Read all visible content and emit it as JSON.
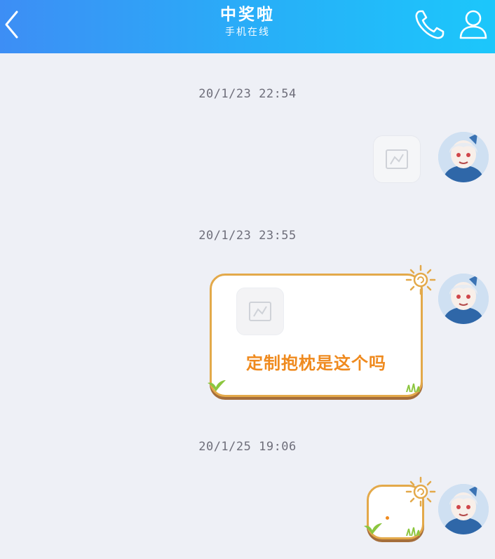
{
  "header": {
    "title": "中奖啦",
    "subtitle": "手机在线",
    "back_icon": "chevron-left-icon",
    "call_icon": "phone-icon",
    "profile_icon": "person-icon"
  },
  "messages": [
    {
      "timestamp": "20/1/23 22:54",
      "type": "image",
      "sender": "self"
    },
    {
      "timestamp": "20/1/23 23:55",
      "type": "image-with-text",
      "text": "定制抱枕是这个吗",
      "sender": "self"
    },
    {
      "timestamp": "20/1/25 19:06",
      "type": "text",
      "text": "",
      "sender": "self"
    }
  ],
  "colors": {
    "header_gradient_start": "#3d8ef5",
    "header_gradient_end": "#1cc7fb",
    "bubble_border": "#e3a94a",
    "bubble_text": "#ef8a1e",
    "background": "#eef0f6"
  }
}
